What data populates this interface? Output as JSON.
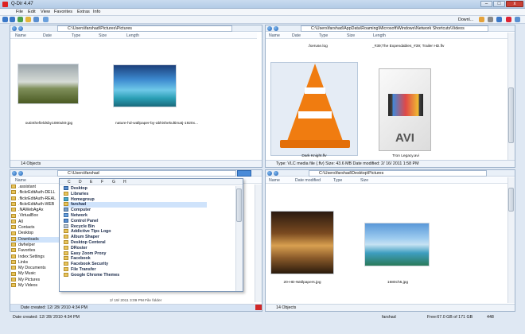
{
  "window": {
    "title": "Q-Dir 4.47",
    "min_symbol": "–",
    "max_symbol": "□",
    "close_symbol": "x",
    "close_color": "#c94035"
  },
  "menu": [
    "File",
    "Edit",
    "View",
    "Favorites",
    "Extras",
    "Info"
  ],
  "toolbar": {
    "download_label": "Downl..."
  },
  "columns": {
    "name": "Name",
    "date": "Date",
    "type": "Type",
    "size": "Size",
    "length": "Length",
    "date_modified": "Date modified"
  },
  "pane_tl": {
    "path": "C:\\Users\\farshad\\Pictures\\Pictures",
    "items": [
      {
        "name": "outinthefieldsby1080uk9.jpg"
      },
      {
        "name": "nature-hd-wallpaper-by-abhishekultimatj-1920x..."
      }
    ],
    "status": "14 Objects"
  },
  "pane_tr": {
    "path": "C:\\Users\\farshad\\AppData\\Roaming\\Microsoft\\Windows\\Network Shortcuts\\Videos",
    "top_names": [
      ".fxeruse.log",
      "_#39;The Expendables_#39; Trailer HD.flv"
    ],
    "items": [
      {
        "name": "Dark Knight.flv"
      },
      {
        "name": "Tron Legacy.avi",
        "badge": "AVI"
      }
    ],
    "status": "Type: VLC media file (.flv) Size: 43.6 MB Date modified: 2/ 16/ 2011  1:58 PM"
  },
  "pane_bl": {
    "path": "C:\\Users\\farshad",
    "tree": [
      ".assistant",
      ".flickrEditAuth-DELL",
      ".flickrEditAuth-REAL",
      ".flickrEditAuth-WEB",
      ".NAWebAgAx",
      ".VirtualBox",
      "All",
      "Contacts",
      "Desktop",
      "Downloads",
      "dwhelper",
      "Favorites",
      "Index Settings",
      "Links",
      "My Documents",
      "My Music",
      "My Pictures",
      "My Videos"
    ],
    "drop_letters": [
      "C",
      "D",
      "E",
      "F",
      "G",
      "H"
    ],
    "dropdown": [
      "Desktop",
      "Libraries",
      "Homegroup",
      "farshad",
      "Computer",
      "Network",
      "Control Panel",
      "Recycle Bin",
      "Addictive Tips Logo",
      "Album Shaper",
      "Desktop Centeral",
      "DRoster",
      "Easy Zoom Proxy",
      "Facebook",
      "Facebook Security",
      "File Transfer",
      "Google Chrome Themes"
    ],
    "behind_row": "2/ 19/ 2011  3:09 PM      File folder",
    "status": "Date created: 12/ 28/ 2010   4:34 PM"
  },
  "pane_br": {
    "path": "C:\\Users\\farshad\\Desktop\\Pictures",
    "items": [
      {
        "name": "20-HD-Wallpapers.jpg"
      },
      {
        "name": "1680ch5.jpg"
      }
    ],
    "status": "14 Objects"
  },
  "bottom": {
    "left": "Date created: 12/ 28/ 2010   4:34 PM",
    "user": "farshad",
    "free": "Free:67.0 GB of 171 GB",
    "count": "448"
  }
}
